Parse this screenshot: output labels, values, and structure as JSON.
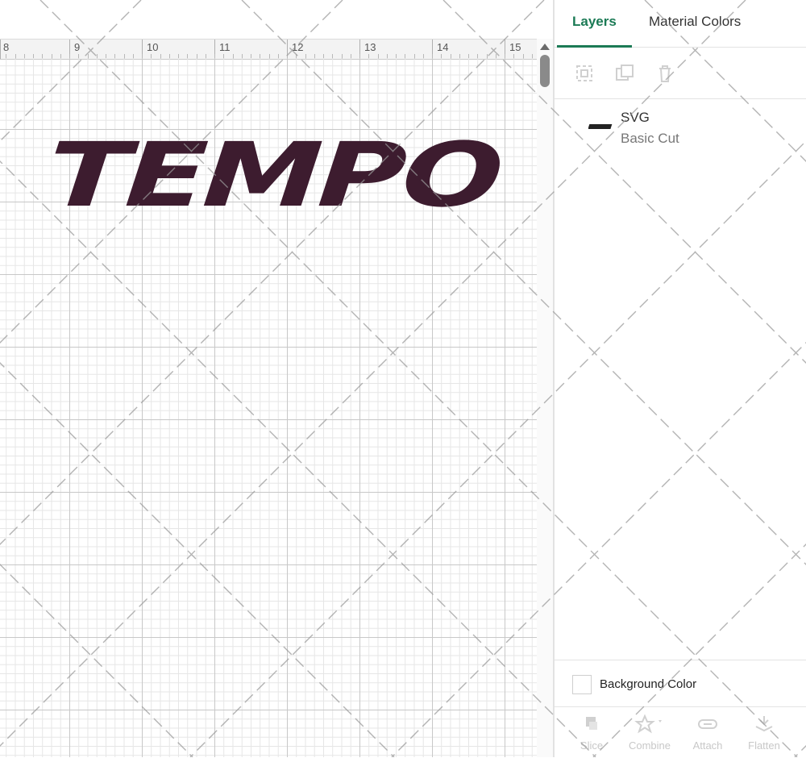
{
  "ruler": {
    "labels": [
      "8",
      "9",
      "10",
      "11",
      "12",
      "13",
      "14",
      "15"
    ]
  },
  "canvas": {
    "design_text": "TEMPO",
    "design_color": "#3d1c2f"
  },
  "panel": {
    "tabs": [
      {
        "label": "Layers",
        "active": true
      },
      {
        "label": "Material Colors",
        "active": false
      }
    ],
    "toolbar_icons": [
      "group-icon",
      "duplicate-icon",
      "delete-icon"
    ],
    "layer": {
      "name": "SVG",
      "type": "Basic Cut"
    },
    "background_color_label": "Background Color",
    "bottom_actions": [
      {
        "label": "Slice",
        "icon": "slice-icon"
      },
      {
        "label": "Combine",
        "icon": "combine-icon"
      },
      {
        "label": "Attach",
        "icon": "attach-icon"
      },
      {
        "label": "Flatten",
        "icon": "flatten-icon"
      }
    ],
    "accent_color": "#1b7a55"
  }
}
